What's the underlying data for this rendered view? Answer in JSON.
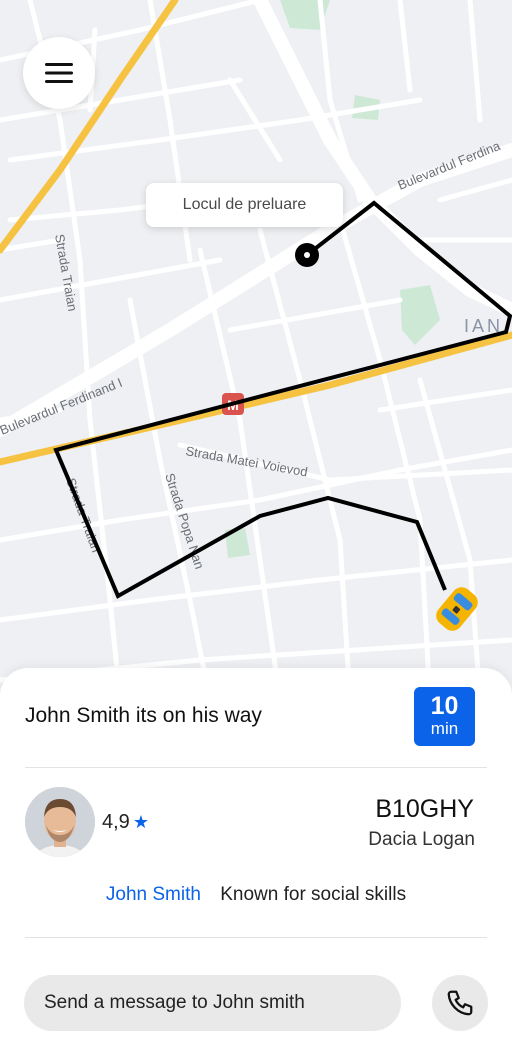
{
  "map": {
    "pickup_label": "Locul de preluare",
    "street_labels": {
      "ferdinand_right": "Bulevardul Ferdina",
      "ferdinand_left": "Bulevardul Ferdinand I",
      "traian_top": "Strada Traian",
      "traian_bottom": "Strada Traian",
      "matei": "Strada Matei Voievod",
      "popa_nan": "Strada Popa Nan",
      "area": "IAN"
    },
    "metro_label": "M",
    "colors": {
      "map_bg": "#eef0f3",
      "road": "#ffffff",
      "main_road": "#f5c242",
      "park": "#cde9d6",
      "route": "#000000",
      "metro": "#d9534f"
    },
    "icons": {
      "menu": "hamburger-menu-icon",
      "pickup": "pickup-pin-icon",
      "car": "taxi-car-icon"
    }
  },
  "trip": {
    "status": "John Smith its on his way",
    "eta_value": "10",
    "eta_unit": "min"
  },
  "driver": {
    "rating": "4,9",
    "plate": "B10GHY",
    "car_model": "Dacia Logan",
    "name": "John Smith",
    "tagline": "Known for social skills"
  },
  "message": {
    "placeholder": "Send a message to John smith"
  },
  "icons": {
    "star": "star-icon",
    "call": "phone-icon"
  },
  "colors": {
    "accent": "#0b63ea",
    "text": "#111111",
    "input_bg": "#e9e9e9"
  }
}
